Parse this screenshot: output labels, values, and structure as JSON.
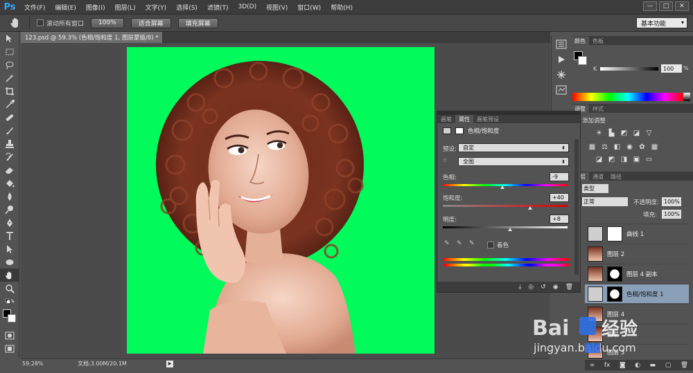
{
  "app": {
    "logo": "Ps",
    "menu": [
      "文件(F)",
      "编辑(E)",
      "图像(I)",
      "图层(L)",
      "文字(Y)",
      "选择(S)",
      "滤镜(T)",
      "3D(D)",
      "视图(V)",
      "窗口(W)",
      "帮助(H)"
    ],
    "window_buttons": [
      "—",
      "□",
      "✕"
    ]
  },
  "options": {
    "scroll_all_label": "滚动所有窗口",
    "btn_100": "100%",
    "btn_fit": "适合屏幕",
    "btn_fill": "填充屏幕",
    "workspace": "基本功能"
  },
  "document": {
    "tab_title": "123.psd @ 59.3% (色相/饱和度 1, 图层蒙版/8) *",
    "tab_close": "×",
    "canvas_color": "#00fb5a"
  },
  "status": {
    "zoom": "59.28%",
    "doc_info": "文档:3.00M/20.1M",
    "arrow": "▶"
  },
  "color_panel": {
    "tabs": [
      "颜色",
      "色板"
    ],
    "k_label": "K",
    "k_value": "100",
    "k_unit": "%"
  },
  "adjust_panel": {
    "tabs": [
      "调整",
      "样式"
    ],
    "title": "添加调整"
  },
  "properties": {
    "tabs": [
      "画笔",
      "属性",
      "画笔预设"
    ],
    "title": "色相/饱和度",
    "preset_label": "预设:",
    "preset_value": "自定",
    "range_value": "全图",
    "hue_label": "色相:",
    "hue_value": "-9",
    "sat_label": "饱和度:",
    "sat_value": "+40",
    "light_label": "明度:",
    "light_value": "+8",
    "colorize_label": "着色",
    "hue": -9,
    "saturation": 40,
    "lightness": 8
  },
  "layers_panel": {
    "tabs": [
      "图层",
      "通道",
      "路径"
    ],
    "filter": "类型",
    "blend": "正常",
    "opacity_label": "不透明度:",
    "opacity_value": "100%",
    "fill_label": "填充:",
    "fill_value": "100%",
    "layers": [
      {
        "name": "曲线 1",
        "kind": "adjustment"
      },
      {
        "name": "图层 2",
        "kind": "photo"
      },
      {
        "name": "图层 4 副本",
        "kind": "photo-mask"
      },
      {
        "name": "色相/饱和度 1",
        "kind": "adjustment-mask",
        "selected": true
      },
      {
        "name": "图层 4",
        "kind": "photo"
      },
      {
        "name": "图层",
        "kind": "photo"
      },
      {
        "name": "图层 3",
        "kind": "photo"
      }
    ]
  },
  "watermark": {
    "brand": "Bai",
    "brand_2": "经验",
    "url": "jingyan.baidu.com"
  }
}
